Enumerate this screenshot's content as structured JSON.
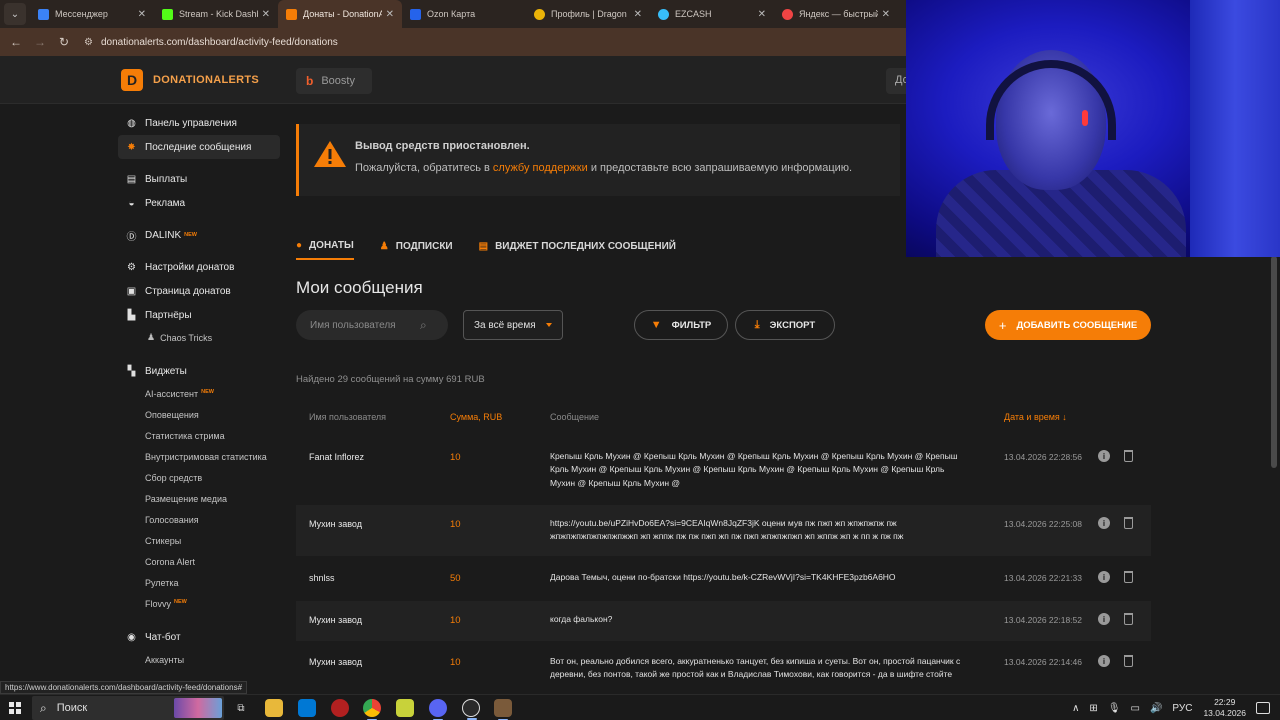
{
  "browser": {
    "tabs": [
      {
        "title": "Мессенджер",
        "color": "#3b82f6",
        "active": false
      },
      {
        "title": "Stream - Kick Dashbo",
        "color": "#53fc18",
        "active": false
      },
      {
        "title": "Донаты - DonationAl",
        "color": "#f57d07",
        "active": true
      },
      {
        "title": "Ozon Карта",
        "color": "#2563eb",
        "active": false
      },
      {
        "title": "Профиль | Dragon M",
        "color": "#eab308",
        "active": false
      },
      {
        "title": "EZCASH",
        "color": "#38bdf8",
        "active": false
      },
      {
        "title": "Яндекс — быстрый",
        "color": "#ef4444",
        "active": false
      }
    ],
    "close_glyph": "✕",
    "url": "donationalerts.com/dashboard/activity-feed/donations"
  },
  "header": {
    "logo_text": "DONATIONALERTS",
    "boosty_label": "Boosty",
    "right_partial": "До"
  },
  "sidebar": {
    "items": [
      {
        "label": "Панель управления",
        "icon": "dashboard-icon"
      },
      {
        "label": "Последние сообщения",
        "icon": "star-icon"
      },
      {
        "label": "Выплаты",
        "icon": "wallet-icon"
      },
      {
        "label": "Реклама",
        "icon": "ads-icon"
      },
      {
        "label": "DALINK",
        "icon": "dalink-icon",
        "badge": "NEW"
      },
      {
        "label": "Настройки донатов",
        "icon": "gear-icon"
      },
      {
        "label": "Страница донатов",
        "icon": "page-icon"
      },
      {
        "label": "Партнёры",
        "icon": "partners-icon"
      },
      {
        "label": "Виджеты",
        "icon": "widgets-icon"
      },
      {
        "label": "Чат-бот",
        "icon": "chatbot-icon"
      }
    ],
    "partner_sub": "Chaos Tricks",
    "widget_subs": [
      {
        "label": "AI-ассистент",
        "badge": "NEW"
      },
      {
        "label": "Оповещения"
      },
      {
        "label": "Статистика стрима"
      },
      {
        "label": "Внутристримовая статистика"
      },
      {
        "label": "Сбор средств"
      },
      {
        "label": "Размещение медиа"
      },
      {
        "label": "Голосования"
      },
      {
        "label": "Стикеры"
      },
      {
        "label": "Corona Alert"
      },
      {
        "label": "Рулетка"
      },
      {
        "label": "Flovvy",
        "badge": "NEW"
      }
    ],
    "chatbot_sub": "Аккаунты"
  },
  "alert": {
    "title": "Вывод средств приостановлен.",
    "text_before": "Пожалуйста, обратитесь в ",
    "link": "службу поддержки",
    "text_after": " и предоставьте всю запрашиваемую информацию."
  },
  "tabs": [
    "ДОНАТЫ",
    "ПОДПИСКИ",
    "ВИДЖЕТ ПОСЛЕДНИХ СООБЩЕНИЙ"
  ],
  "page_title": "Мои сообщения",
  "filters": {
    "search_placeholder": "Имя пользователя",
    "period": "За всё время",
    "filter_label": "ФИЛЬТР",
    "export_label": "ЭКСПОРТ",
    "add_label": "ДОБАВИТЬ СООБЩЕНИЕ"
  },
  "found_text": "Найдено 29 сообщений на сумму 691 RUB",
  "table": {
    "headers": {
      "user": "Имя пользователя",
      "sum": "Сумма, RUB",
      "message": "Сообщение",
      "date": "Дата и время ↓"
    },
    "rows": [
      {
        "user": "Fanat Inflorez",
        "sum": "10",
        "message": "Крепыш Крль Мухин @ Крепыш Крль Мухин @ Крепыш Крль Мухин @ Крепыш Крль Мухин @ Крепыш Крль Мухин @ Крепыш Крль Мухин @ Крепыш Крль Мухин @ Крепыш Крль Мухин @ Крепыш Крль Мухин @ Крепыш Крль Мухин @",
        "date": "13.04.2026 22:28:56"
      },
      {
        "user": "Мухин завод",
        "sum": "10",
        "message": "https://youtu.be/uPZiHvDo6EA?si=9CEAIqWn8JqZF3jK оцени мув пж пжп жп жпжпжпж пж жпжпжпжпжпжпжпжжп жп жппж пж пж пжп жп пж пжп жпжпжпжп жп жппж жп ж пп ж пж пж",
        "date": "13.04.2026 22:25:08"
      },
      {
        "user": "shnlss",
        "sum": "50",
        "message": "Дарова Темыч, оцени по-братски https://youtu.be/k-CZRevWVjI?si=TK4KHFE3pzb6A6HO",
        "date": "13.04.2026 22:21:33"
      },
      {
        "user": "Мухин завод",
        "sum": "10",
        "message": "когда фалькон?",
        "date": "13.04.2026 22:18:52"
      },
      {
        "user": "Мухин завод",
        "sum": "10",
        "message": "Вот он, реально добился всего, аккуратненько танцует, без кипиша и суеты. Вот он, простой пацанчик с деревни, без понтов, такой же простой как и Владислав Тимохови, как говорится - да в шифте стойте",
        "date": "13.04.2026 22:14:46"
      }
    ]
  },
  "status_url": "https://www.donationalerts.com/dashboard/activity-feed/donations#",
  "taskbar": {
    "search_label": "Поиск",
    "language": "РУС",
    "time": "22:29",
    "date": "13.04.2026"
  }
}
